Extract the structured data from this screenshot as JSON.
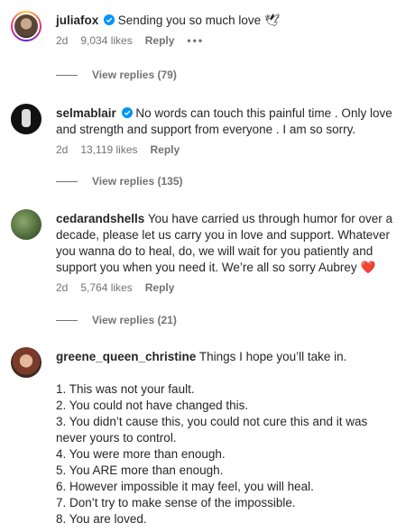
{
  "comments": [
    {
      "username": "juliafox",
      "verified": true,
      "text": "Sending you so much love",
      "emoji": "🕊",
      "age": "2d",
      "likes": "9,034 likes",
      "reply_label": "Reply",
      "more_label": "•••",
      "view_replies": "View replies (79)"
    },
    {
      "username": "selmablair",
      "verified": true,
      "text_line1": "No words can touch this painful time . Only love",
      "text_line2": "and strength and support from everyone . I am so sorry.",
      "age": "2d",
      "likes": "13,119 likes",
      "reply_label": "Reply",
      "view_replies": "View replies (135)"
    },
    {
      "username": "cedarandshells",
      "text_line1": "You have carried us through humor for over a",
      "text_line2": "decade, please let us carry you in love and support. Whatever",
      "text_line3": "you wanna do to heal, do, we will wait for you patiently and",
      "text_line4": "support you when you need it. We’re all so sorry Aubrey",
      "emoji": "❤️",
      "age": "2d",
      "likes": "5,764 likes",
      "reply_label": "Reply",
      "view_replies": "View replies (21)"
    },
    {
      "username": "greene_queen_christine",
      "text_line1": "Things I hope you’ll take in.",
      "list": [
        "1. This was not your fault.",
        "2. You could not have changed this.",
        "3. You didn’t cause this, you could not cure this and it was",
        "never yours to control.",
        "4. You were more than enough.",
        "5. You ARE more than enough.",
        "6. However impossible it may feel, you will heal.",
        "7. Don’t try to make sense of the impossible.",
        "8. You are loved."
      ]
    }
  ],
  "colors": {
    "verified": "#0095f6",
    "secondary_text": "#737373",
    "heart": "#c8102e"
  }
}
